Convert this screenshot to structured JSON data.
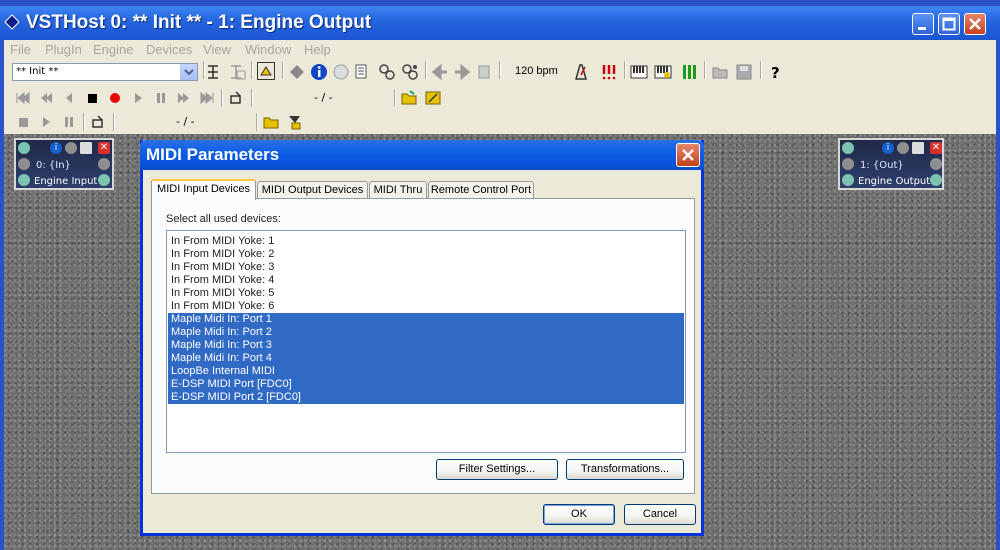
{
  "window": {
    "title": "VSTHost 0: ** Init ** - 1: Engine Output"
  },
  "menu": [
    "File",
    "PlugIn",
    "Engine",
    "Devices",
    "View",
    "Window",
    "Help"
  ],
  "toolbar": {
    "preset": "** Init **",
    "bpm": "120 bpm",
    "position1": "- / -",
    "position2": "- / -"
  },
  "engine_input": {
    "channel": "0: {In}",
    "name": "Engine Input"
  },
  "engine_output": {
    "channel": "1: {Out}",
    "name": "Engine Output"
  },
  "dialog": {
    "title": "MIDI Parameters",
    "tabs": [
      "MIDI Input Devices",
      "MIDI Output Devices",
      "MIDI Thru",
      "Remote Control Port"
    ],
    "label": "Select all used devices:",
    "devices": [
      {
        "name": "In From MIDI Yoke:  1",
        "selected": false
      },
      {
        "name": "In From MIDI Yoke:  2",
        "selected": false
      },
      {
        "name": "In From MIDI Yoke:  3",
        "selected": false
      },
      {
        "name": "In From MIDI Yoke:  4",
        "selected": false
      },
      {
        "name": "In From MIDI Yoke:  5",
        "selected": false
      },
      {
        "name": "In From MIDI Yoke:  6",
        "selected": false
      },
      {
        "name": "Maple Midi In: Port 1",
        "selected": true
      },
      {
        "name": "Maple Midi In: Port 2",
        "selected": true
      },
      {
        "name": "Maple Midi In: Port 3",
        "selected": true
      },
      {
        "name": "Maple Midi In: Port 4",
        "selected": true
      },
      {
        "name": "LoopBe Internal MIDI",
        "selected": true
      },
      {
        "name": "E-DSP MIDI Port [FDC0]",
        "selected": true
      },
      {
        "name": "E-DSP MIDI Port 2 [FDC0]",
        "selected": true
      }
    ],
    "filter_button": "Filter Settings...",
    "transform_button": "Transformations...",
    "ok_button": "OK",
    "cancel_button": "Cancel"
  },
  "colors": {
    "titlebar": "#2766e0",
    "selection": "#316ac5",
    "dialog_bg": "#ece9d8"
  }
}
